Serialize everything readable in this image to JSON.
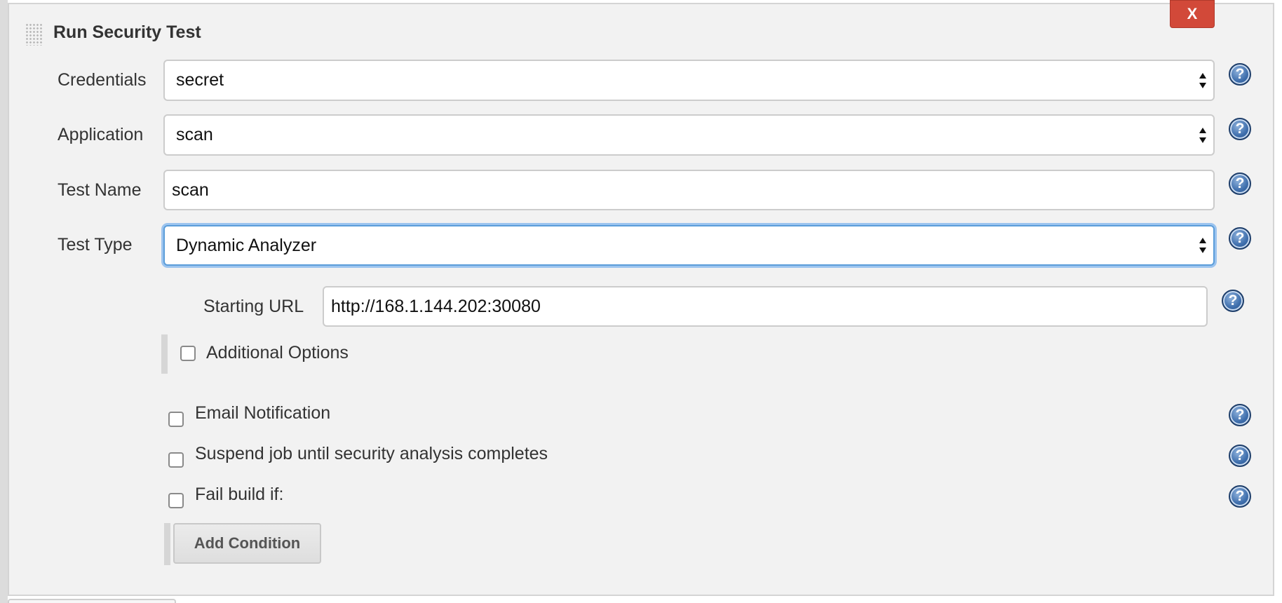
{
  "section": {
    "title": "Run Security Test",
    "close_label": "X"
  },
  "fields": {
    "credentials": {
      "label": "Credentials",
      "value": "secret"
    },
    "application": {
      "label": "Application",
      "value": "scan"
    },
    "test_name": {
      "label": "Test Name",
      "value": "scan"
    },
    "test_type": {
      "label": "Test Type",
      "value": "Dynamic Analyzer"
    },
    "starting_url": {
      "label": "Starting URL",
      "value": "http://168.1.144.202:30080"
    }
  },
  "options": {
    "additional_options": {
      "label": "Additional Options",
      "checked": false
    },
    "email_notification": {
      "label": "Email Notification",
      "checked": false
    },
    "suspend_job": {
      "label": "Suspend job until security analysis completes",
      "checked": false
    },
    "fail_build": {
      "label": "Fail build if:",
      "checked": false
    }
  },
  "buttons": {
    "add_condition": "Add Condition"
  },
  "help_icon_glyph": "?",
  "colors": {
    "close_button": "#d24939",
    "help_icon": "#3f6fad",
    "focus_ring": "#5b9dd9",
    "panel_background": "#f2f2f2"
  }
}
